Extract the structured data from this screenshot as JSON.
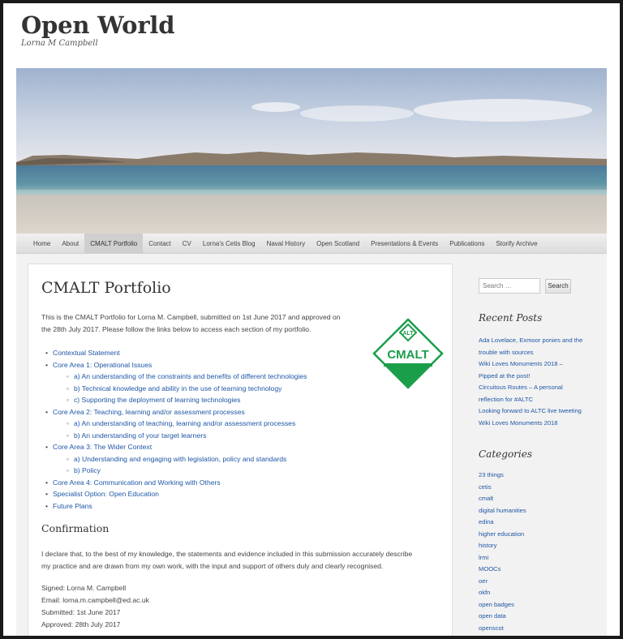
{
  "site": {
    "title": "Open World",
    "description": "Lorna M Campbell"
  },
  "nav": {
    "items": [
      {
        "label": "Home"
      },
      {
        "label": "About"
      },
      {
        "label": "CMALT Portfolio",
        "active": true
      },
      {
        "label": "Contact"
      },
      {
        "label": "CV"
      },
      {
        "label": "Lorna's Cetis Blog"
      },
      {
        "label": "Naval History"
      },
      {
        "label": "Open Scotland"
      },
      {
        "label": "Presentations & Events"
      },
      {
        "label": "Publications"
      },
      {
        "label": "Storify Archive"
      }
    ]
  },
  "content": {
    "title": "CMALT Portfolio",
    "intro_line1": "This is the CMALT Portfolio for Lorna M. Campbell, submitted on 1st June 2017 and approved on",
    "intro_line2": "the 28th July 2017. Please follow the links below to access each section of my portfolio.",
    "logo_badge": "ALT",
    "logo_text": "CMALT",
    "toc": [
      {
        "label": "Contextual Statement",
        "level": 1
      },
      {
        "label": "Core Area 1: Operational Issues",
        "level": 1
      },
      {
        "label": "a) An understanding of the constraints and benefits of different technologies",
        "level": 2
      },
      {
        "label": "b) Technical knowledge and ability in the use of learning technology",
        "level": 2
      },
      {
        "label": "c) Supporting the deployment of learning technologies",
        "level": 2
      },
      {
        "label": "Core Area 2: Teaching, learning and/or assessment processes",
        "level": 1
      },
      {
        "label": "a) An understanding of teaching, learning and/or assessment processes",
        "level": 2
      },
      {
        "label": "b) An understanding of your target learners",
        "level": 2
      },
      {
        "label": "Core Area 3: The Wider Context",
        "level": 1
      },
      {
        "label": "a) Understanding and engaging with legislation, policy and standards",
        "level": 2
      },
      {
        "label": "b) Policy",
        "level": 2
      },
      {
        "label": "Core Area 4: Communication and Working with Others",
        "level": 1
      },
      {
        "label": "Specialist Option: Open Education",
        "level": 1
      },
      {
        "label": "Future Plans",
        "level": 1
      }
    ],
    "confirmation_heading": "Confirmation",
    "confirmation_line1": "I declare that, to the best of my knowledge, the statements and evidence included in this submission accurately describe",
    "confirmation_line2": "my practice and are drawn from my own work, with the input and support of others duly and clearly recognised.",
    "signed": "Signed: Lorna M. Campbell",
    "email": "Email: lorna.m.campbell@ed.ac.uk",
    "submitted": "Submitted: 1st June 2017",
    "approved": "Approved: 28th July 2017"
  },
  "sidebar": {
    "search_placeholder": "Search …",
    "search_button": "Search",
    "recent_posts_title": "Recent Posts",
    "recent_posts": [
      "Ada Lovelace, Exmoor ponies and the",
      "trouble with sources",
      "Wiki Loves Monuments 2018 –",
      "Pipped at the post!",
      "Circuitous Routes – A personal",
      "reflection for #ALTC",
      "Looking forward to ALTC live tweeting",
      "Wiki Loves Monuments 2018"
    ],
    "categories_title": "Categories",
    "categories": [
      "23 things",
      "cetis",
      "cmalt",
      "digital humanities",
      "edina",
      "higher education",
      "history",
      "lrmi",
      "MOOCs",
      "oer",
      "okfn",
      "open badges",
      "open data",
      "openscot"
    ]
  },
  "colors": {
    "link": "#1e57a6",
    "logo_green": "#1a9e4a"
  }
}
